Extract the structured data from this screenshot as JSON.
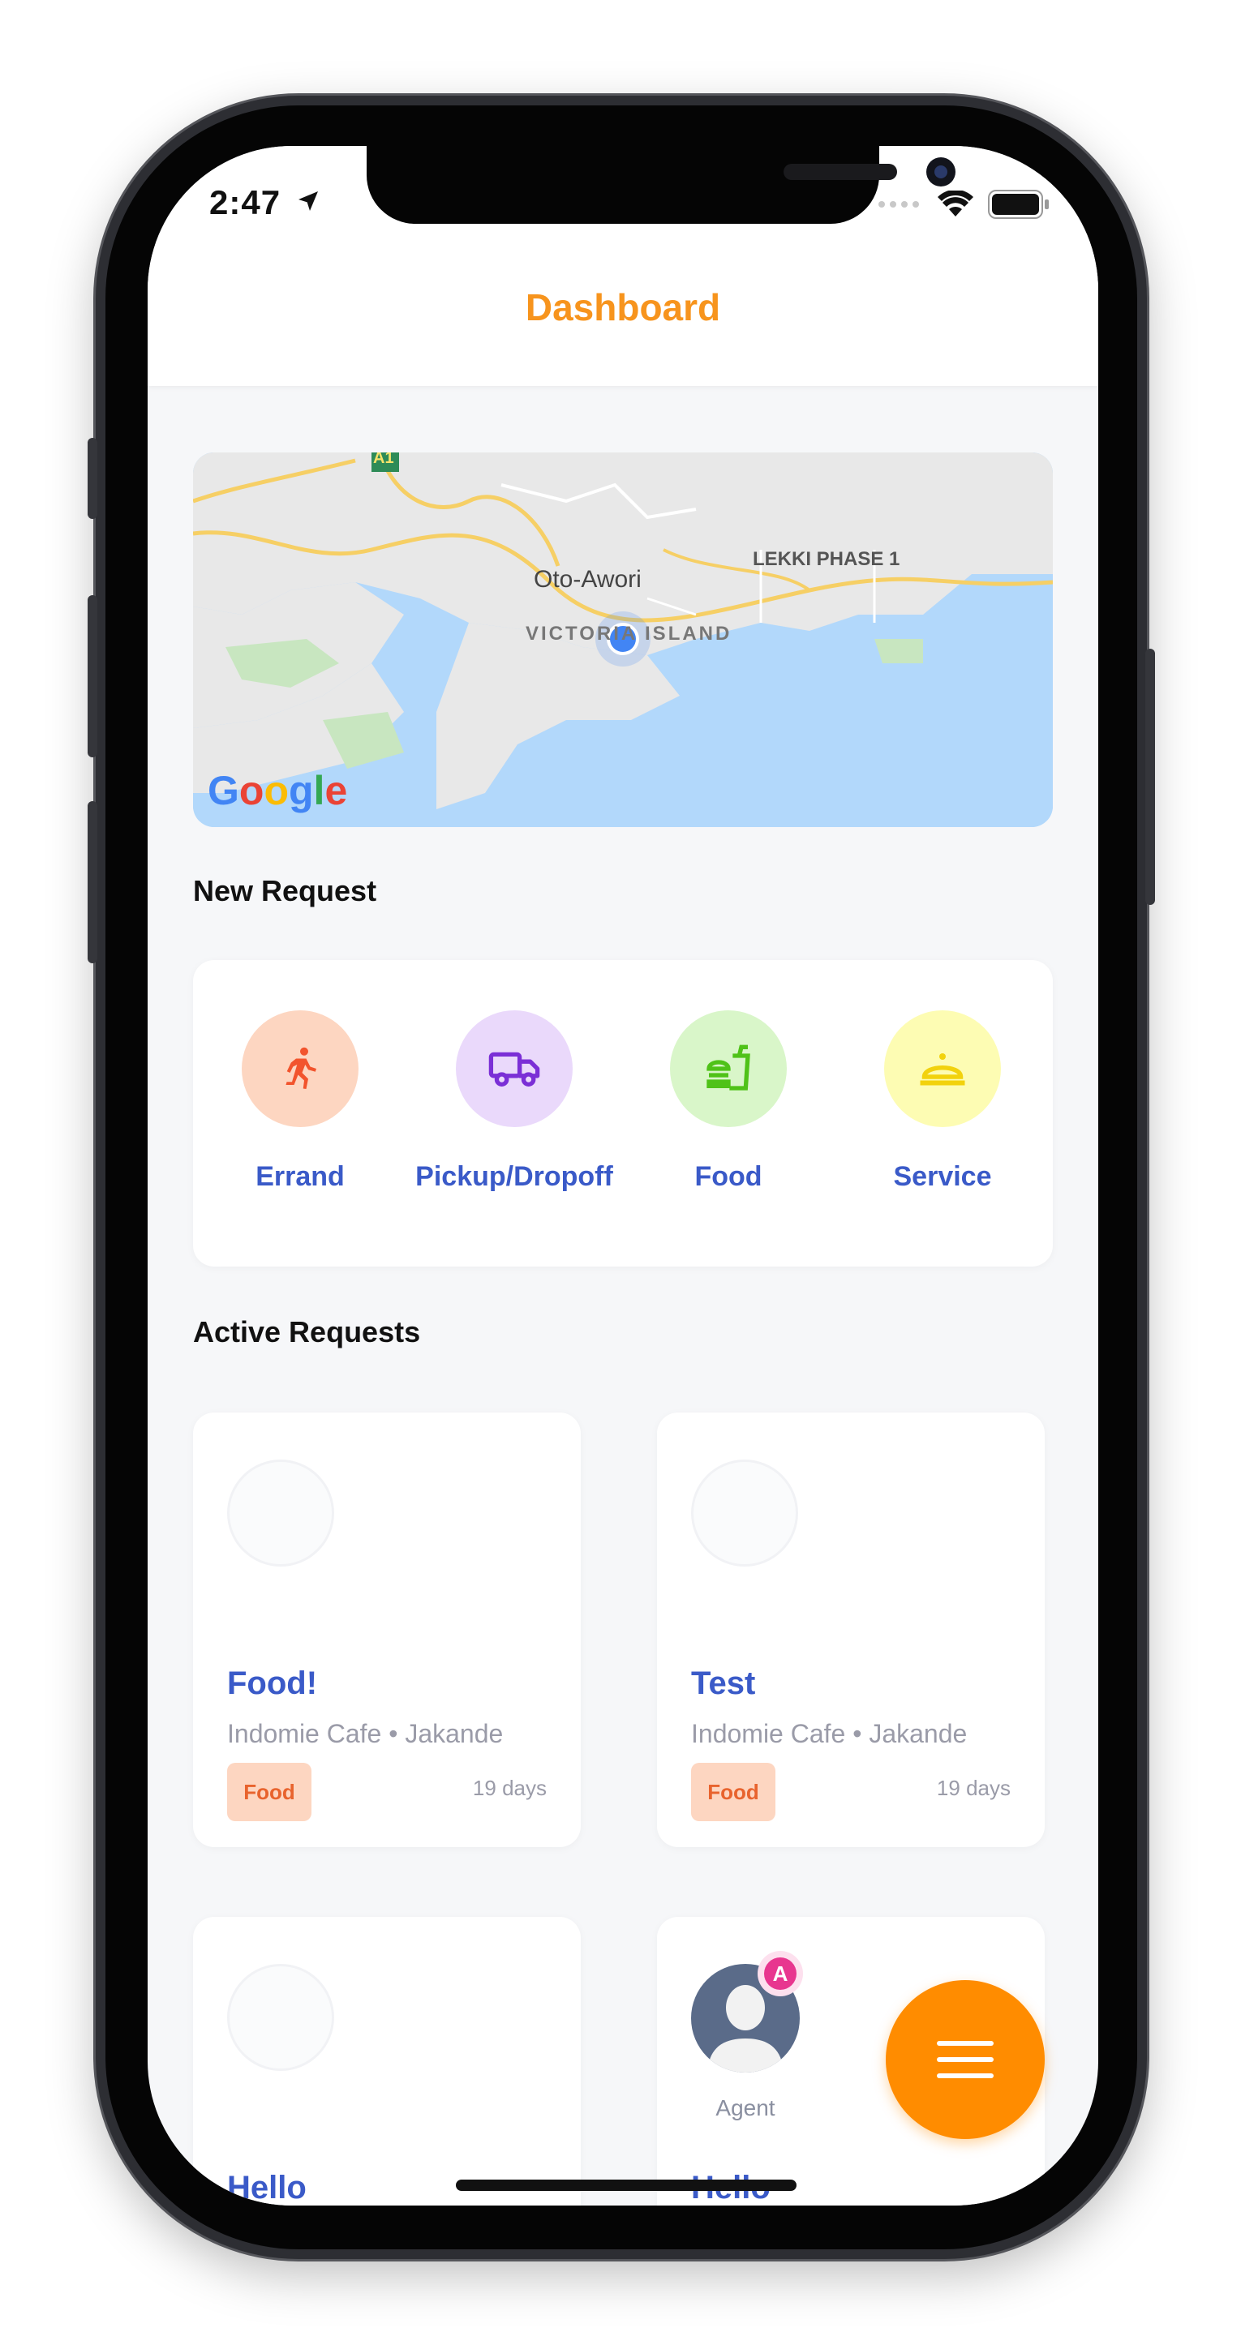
{
  "status": {
    "time": "2:47"
  },
  "header": {
    "title": "Dashboard"
  },
  "map": {
    "labels": {
      "area1": "Oto-Awori",
      "area2": "LEKKI PHASE 1",
      "area3": "VICTORIA ISLAND",
      "road": "A1"
    },
    "provider": "Google"
  },
  "new_request": {
    "title": "New Request",
    "items": [
      {
        "label": "Errand",
        "icon": "running-person-icon",
        "bg": "#fdd6c1",
        "color": "#f2542d"
      },
      {
        "label": "Pickup/Dropoff",
        "icon": "truck-icon",
        "bg": "#ead9fb",
        "color": "#7b2fd6"
      },
      {
        "label": "Food",
        "icon": "burger-drink-icon",
        "bg": "#d9f6c9",
        "color": "#4fc218"
      },
      {
        "label": "Service",
        "icon": "cloche-icon",
        "bg": "#fdfcb3",
        "color": "#f2d20d"
      }
    ]
  },
  "active_requests": {
    "title": "Active Requests",
    "cards": [
      {
        "title": "Food!",
        "subtitle": "Indomie Cafe • Jakande",
        "badge": "Food",
        "time": "19 days"
      },
      {
        "title": "Test",
        "subtitle": "Indomie Cafe • Jakande",
        "badge": "Food",
        "time": "19 days"
      },
      {
        "title": "Hello"
      },
      {
        "title": "Hello",
        "agent_label": "Agent",
        "agent_badge": "A"
      }
    ]
  },
  "colors": {
    "accent": "#f7941d",
    "fab": "#ff8c00",
    "link": "#3a5ac8"
  }
}
